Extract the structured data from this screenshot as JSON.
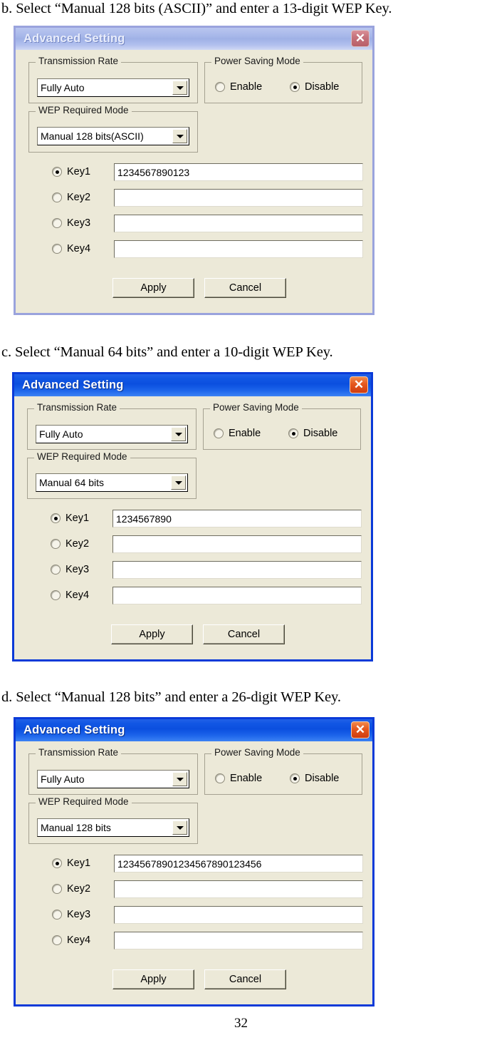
{
  "page": {
    "number": "32"
  },
  "sections": [
    {
      "caption": "b. Select “Manual 128 bits (ASCII)” and enter a 13-digit WEP Key.",
      "dialog": {
        "title": "Advanced Setting",
        "close_label": "✕",
        "transmission_rate": {
          "legend": "Transmission Rate",
          "value": "Fully Auto"
        },
        "power_saving": {
          "legend": "Power Saving Mode",
          "enable_label": "Enable",
          "disable_label": "Disable",
          "selected": "Disable"
        },
        "wep_mode": {
          "legend": "WEP Required Mode",
          "value": "Manual 128 bits(ASCII)"
        },
        "keys": [
          {
            "label": "Key1",
            "value": "1234567890123",
            "selected": true
          },
          {
            "label": "Key2",
            "value": "",
            "selected": false
          },
          {
            "label": "Key3",
            "value": "",
            "selected": false
          },
          {
            "label": "Key4",
            "value": "",
            "selected": false
          }
        ],
        "apply_label": "Apply",
        "cancel_label": "Cancel"
      }
    },
    {
      "caption": "c. Select “Manual 64 bits” and enter a 10-digit WEP Key.",
      "dialog": {
        "title": "Advanced Setting",
        "close_label": "✕",
        "transmission_rate": {
          "legend": "Transmission Rate",
          "value": "Fully Auto"
        },
        "power_saving": {
          "legend": "Power Saving Mode",
          "enable_label": "Enable",
          "disable_label": "Disable",
          "selected": "Disable"
        },
        "wep_mode": {
          "legend": "WEP Required Mode",
          "value": "Manual 64 bits"
        },
        "keys": [
          {
            "label": "Key1",
            "value": "1234567890",
            "selected": true
          },
          {
            "label": "Key2",
            "value": "",
            "selected": false
          },
          {
            "label": "Key3",
            "value": "",
            "selected": false
          },
          {
            "label": "Key4",
            "value": "",
            "selected": false
          }
        ],
        "apply_label": "Apply",
        "cancel_label": "Cancel"
      }
    },
    {
      "caption": "d. Select “Manual 128 bits” and enter a 26-digit WEP Key.",
      "dialog": {
        "title": "Advanced Setting",
        "close_label": "✕",
        "transmission_rate": {
          "legend": "Transmission Rate",
          "value": "Fully Auto"
        },
        "power_saving": {
          "legend": "Power Saving Mode",
          "enable_label": "Enable",
          "disable_label": "Disable",
          "selected": "Disable"
        },
        "wep_mode": {
          "legend": "WEP Required Mode",
          "value": "Manual 128 bits"
        },
        "keys": [
          {
            "label": "Key1",
            "value": "12345678901234567890123456",
            "selected": true
          },
          {
            "label": "Key2",
            "value": "",
            "selected": false
          },
          {
            "label": "Key3",
            "value": "",
            "selected": false
          },
          {
            "label": "Key4",
            "value": "",
            "selected": false
          }
        ],
        "apply_label": "Apply",
        "cancel_label": "Cancel"
      }
    }
  ]
}
